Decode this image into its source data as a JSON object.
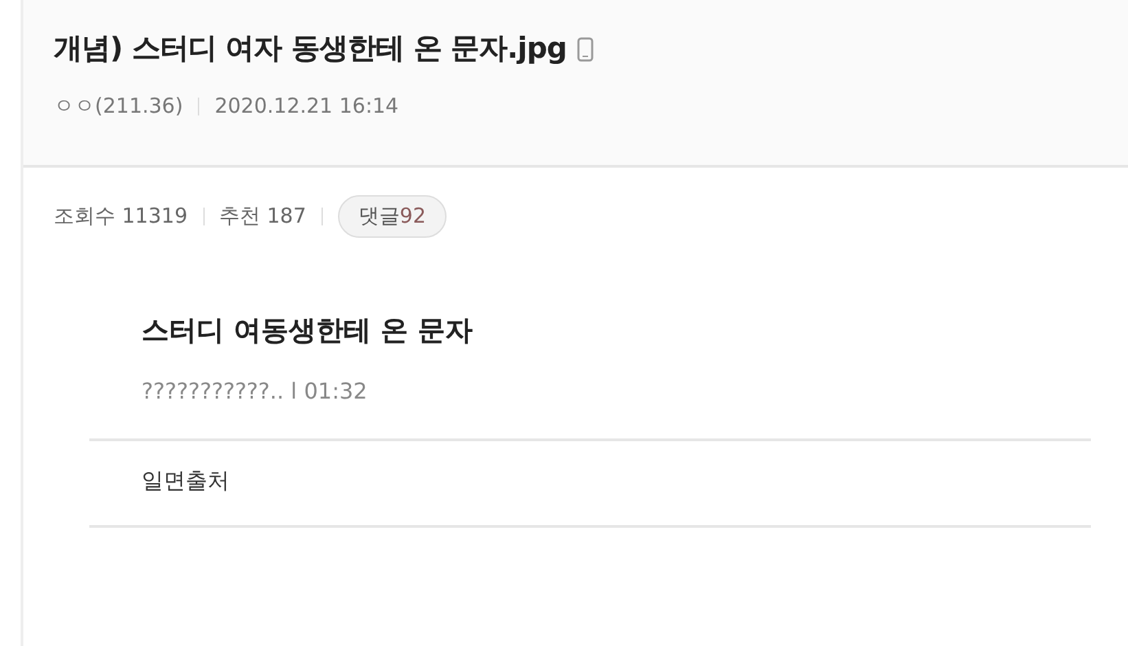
{
  "post": {
    "title": "개념) 스터디 여자 동생한테 온 문자.jpg",
    "author": "ㅇㅇ(211.36)",
    "date": "2020.12.21 16:14"
  },
  "stats": {
    "views": "조회수 11319",
    "recommend": "추천 187",
    "comments": "댓글",
    "comment_count": "92"
  },
  "body": {
    "heading": "스터디 여동생한테 온 문자",
    "subline": "???????????.. l 01:32",
    "source": "일면출처"
  }
}
